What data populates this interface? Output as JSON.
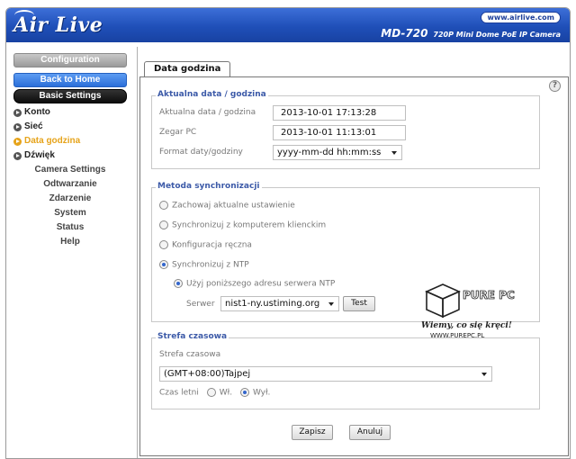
{
  "header": {
    "logo_text": "Air Live",
    "url": "www.airlive.com",
    "model": "MD-720",
    "model_desc": "720P Mini Dome PoE IP Camera"
  },
  "sidebar": {
    "config_label": "Configuration",
    "home_label": "Back to Home",
    "basic_label": "Basic Settings",
    "items": [
      {
        "label": "Konto"
      },
      {
        "label": "Sieć"
      },
      {
        "label": "Data godzina",
        "active": true
      },
      {
        "label": "Dźwięk"
      }
    ],
    "categories": [
      "Camera Settings",
      "Odtwarzanie",
      "Zdarzenie",
      "System",
      "Status",
      "Help"
    ]
  },
  "tab": {
    "label": "Data godzina"
  },
  "datetime": {
    "legend": "Aktualna data / godzina",
    "current_label": "Aktualna data / godzina",
    "current_value": "2013-10-01    17:13:28",
    "pc_label": "Zegar PC",
    "pc_value": "2013-10-01    11:13:01",
    "format_label": "Format daty/godziny",
    "format_value": "yyyy-mm-dd hh:mm:ss"
  },
  "sync": {
    "legend": "Metoda synchronizacji",
    "options": [
      {
        "label": "Zachowaj aktualne ustawienie",
        "selected": false
      },
      {
        "label": "Synchronizuj z komputerem klienckim",
        "selected": false
      },
      {
        "label": "Konfiguracja ręczna",
        "selected": false
      },
      {
        "label": "Synchronizuj z NTP",
        "selected": true
      }
    ],
    "ntp_option": "Użyj poniższego adresu serwera NTP",
    "server_label": "Serwer",
    "server_value": "nist1-ny.ustiming.org",
    "test_label": "Test"
  },
  "timezone": {
    "legend": "Strefa czasowa",
    "label": "Strefa czasowa",
    "value": "(GMT+08:00)Tajpej",
    "dst_label": "Czas letni",
    "dst_on": "Wł.",
    "dst_off": "Wył."
  },
  "actions": {
    "save": "Zapisz",
    "cancel": "Anuluj"
  },
  "watermark": {
    "text_top": "PURE PC",
    "text_mid": "Wiemy, co się kręci!",
    "text_bot": "WWW.PUREPC.PL"
  },
  "colors": {
    "header_blue": "#2a5bc8",
    "active_orange": "#e6a31a",
    "legend_blue": "#3c5aa8"
  }
}
